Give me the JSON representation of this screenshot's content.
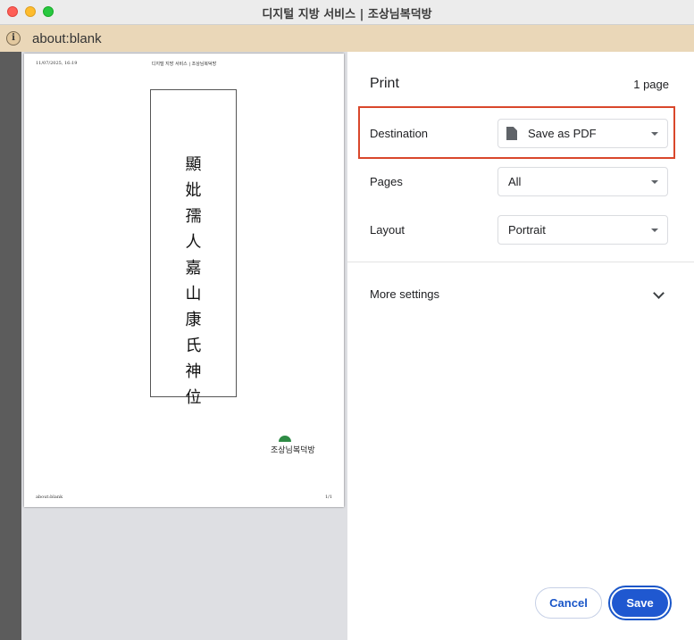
{
  "window": {
    "title": "디지털 지방 서비스 | 조상님복덕방"
  },
  "address_bar": {
    "url": "about:blank",
    "info_icon": "i"
  },
  "preview": {
    "header_date": "11/07/2025, 16:19",
    "header_title": "디지털 지방 서비스 | 조상님복덕방",
    "tablet_chars": [
      "顯",
      "妣",
      "孺",
      "人",
      "嘉",
      "山",
      "康",
      "氏",
      "神",
      "位"
    ],
    "logo_text": "조상님복덕방",
    "footer_left": "about:blank",
    "footer_right": "1/1"
  },
  "print_panel": {
    "title": "Print",
    "page_count": "1 page",
    "destination": {
      "label": "Destination",
      "value": "Save as PDF"
    },
    "pages": {
      "label": "Pages",
      "value": "All"
    },
    "layout": {
      "label": "Layout",
      "value": "Portrait"
    },
    "more_settings": "More settings",
    "cancel_label": "Cancel",
    "save_label": "Save"
  },
  "colors": {
    "accent": "#1f58d0",
    "highlight_border": "#d9472b",
    "logo_green": "#2e8b45",
    "address_bar": "#ead7b8"
  }
}
